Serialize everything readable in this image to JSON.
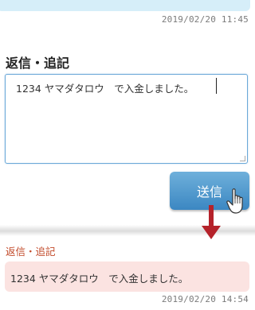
{
  "previous_message": {
    "timestamp": "2019/02/20 11:45"
  },
  "reply_section": {
    "title": "返信・追記",
    "textarea_value": "1234 ヤマダタロウ　で入金しました。",
    "send_label": "送信"
  },
  "posted_message": {
    "label": "返信・追記",
    "text": "1234 ヤマダタロウ　で入金しました。",
    "timestamp": "2019/02/20 14:54"
  },
  "colors": {
    "button": "#4a98cf",
    "posted_label": "#c24a2a",
    "posted_bubble": "#fbe3e1",
    "arrow": "#b5222a",
    "previous_bubble": "#d6eef9"
  }
}
